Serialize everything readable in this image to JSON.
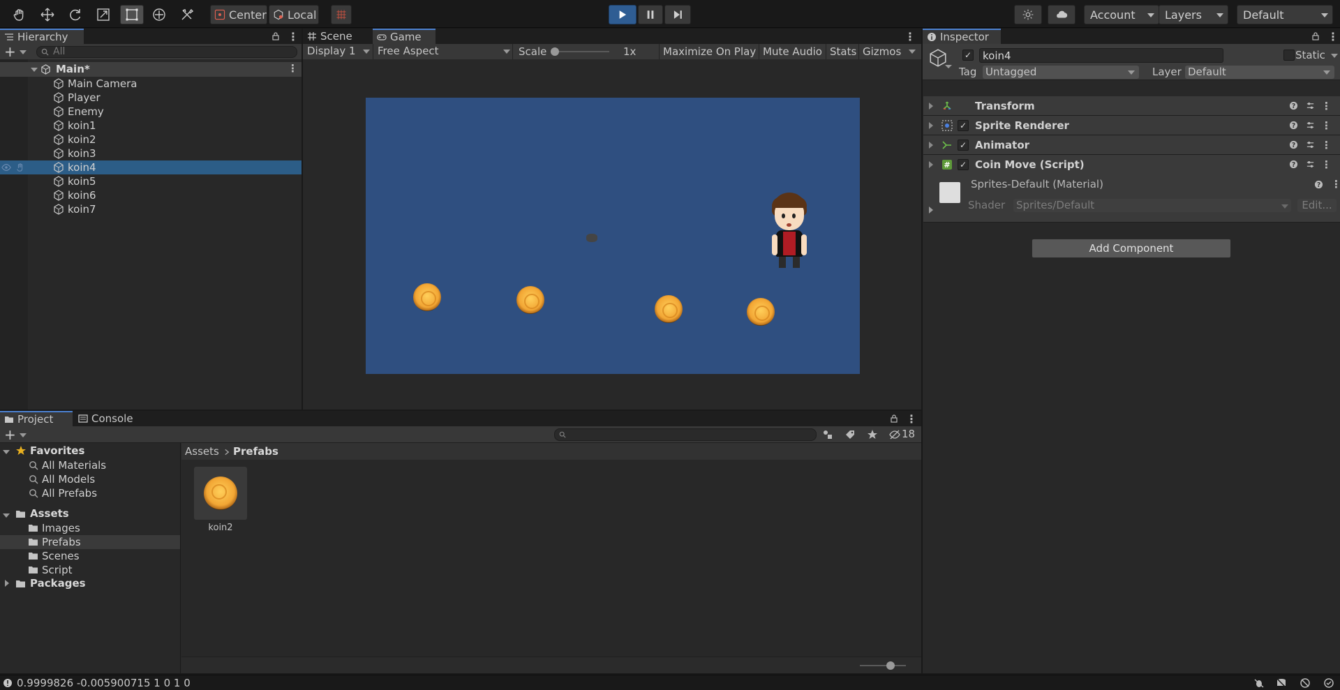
{
  "toolbar": {
    "tools": [
      "hand-icon",
      "move-icon",
      "rotate-icon",
      "scale-icon",
      "rect-icon",
      "transform-icon",
      "custom-tool-icon"
    ],
    "pivot_label": "Center",
    "space_label": "Local",
    "account_label": "Account",
    "layers_label": "Layers",
    "layout_label": "Default"
  },
  "hierarchy": {
    "tab_label": "Hierarchy",
    "search_placeholder": "All",
    "scene_name": "Main*",
    "items": [
      {
        "label": "Main Camera"
      },
      {
        "label": "Player"
      },
      {
        "label": "Enemy"
      },
      {
        "label": "koin1"
      },
      {
        "label": "koin2"
      },
      {
        "label": "koin3"
      },
      {
        "label": "koin4",
        "selected": true
      },
      {
        "label": "koin5"
      },
      {
        "label": "koin6"
      },
      {
        "label": "koin7"
      }
    ]
  },
  "game": {
    "tabs": [
      {
        "label": "Scene"
      },
      {
        "label": "Game"
      }
    ],
    "display": "Display 1",
    "aspect": "Free Aspect",
    "scale_label": "Scale",
    "scale_value": "1x",
    "buttons": [
      "Maximize On Play",
      "Mute Audio",
      "Stats",
      "Gizmos"
    ],
    "background_color": "#2f4f80",
    "coin_count": 4
  },
  "inspector": {
    "tab_label": "Inspector",
    "object_name": "koin4",
    "static_label": "Static",
    "tag_label": "Tag",
    "tag_value": "Untagged",
    "layer_label": "Layer",
    "layer_value": "Default",
    "components": [
      {
        "name": "Transform",
        "icon": "transform-icon",
        "checkbox": false
      },
      {
        "name": "Sprite Renderer",
        "icon": "sprite-renderer-icon",
        "checkbox": true
      },
      {
        "name": "Animator",
        "icon": "animator-icon",
        "checkbox": true
      },
      {
        "name": "Coin Move (Script)",
        "icon": "script-icon",
        "checkbox": true
      }
    ],
    "material_name": "Sprites-Default (Material)",
    "shader_label": "Shader",
    "shader_value": "Sprites/Default",
    "edit_label": "Edit...",
    "add_component_label": "Add Component"
  },
  "project": {
    "tabs": [
      {
        "label": "Project"
      },
      {
        "label": "Console"
      }
    ],
    "favorites_label": "Favorites",
    "favorites": [
      "All Materials",
      "All Models",
      "All Prefabs"
    ],
    "assets_label": "Assets",
    "asset_folders": [
      "Images",
      "Prefabs",
      "Scenes",
      "Script"
    ],
    "packages_label": "Packages",
    "breadcrumb": [
      "Assets",
      "Prefabs"
    ],
    "hidden_count": "18",
    "files": [
      {
        "label": "koin2"
      }
    ]
  },
  "status": {
    "message": "0.9999826 -0.005900715 1 0 1 0"
  },
  "colors": {
    "accent": "#4b80d0",
    "selection": "#2c5d87",
    "play_active": "#3b6ea8"
  }
}
